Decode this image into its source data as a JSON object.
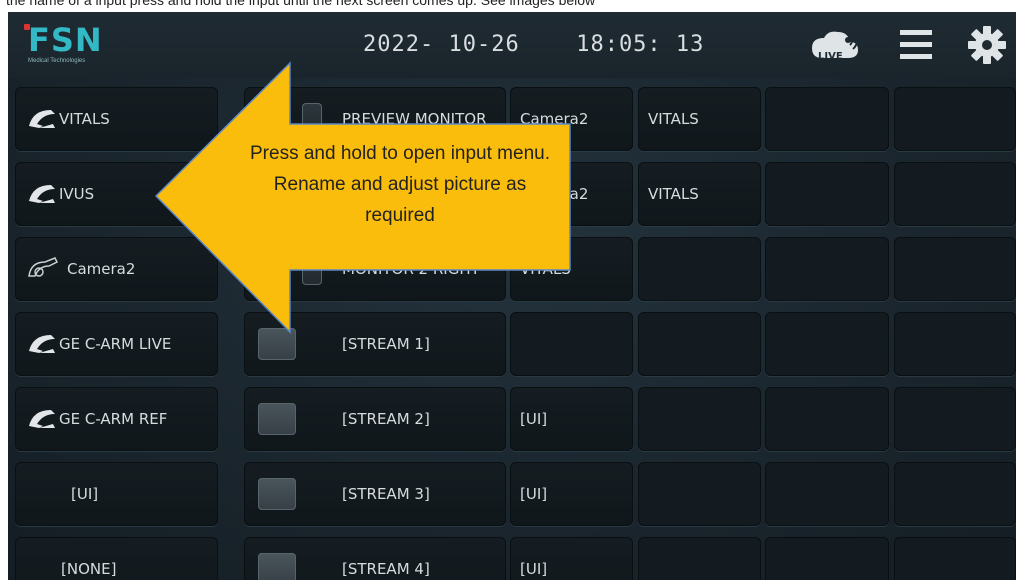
{
  "caption": "the name of a input press and hold the input until the next screen comes up. See images below",
  "header": {
    "brand": "FSN",
    "brand_sub": "Medical Technologies",
    "date": "2022- 10-26",
    "time": "18:05: 13",
    "live_label": "LIVE"
  },
  "inputs": [
    {
      "label": "VITALS",
      "icon": "c-arm-icon"
    },
    {
      "label": "IVUS",
      "icon": "c-arm-icon"
    },
    {
      "label": "Camera2",
      "icon": "camera-icon"
    },
    {
      "label": "GE  C-ARM LIVE",
      "icon": "c-arm-icon"
    },
    {
      "label": "GE C-ARM REF",
      "icon": "c-arm-icon"
    },
    {
      "label": "[UI]",
      "icon": ""
    },
    {
      "label": "[NONE]",
      "icon": ""
    }
  ],
  "monitors": [
    {
      "label": "PREVIEW MONITOR"
    },
    {
      "label": ""
    },
    {
      "label": "MONITOR 2 RIGHT"
    },
    {
      "label": "[STREAM 1]"
    },
    {
      "label": "[STREAM 2]"
    },
    {
      "label": "[STREAM 3]"
    },
    {
      "label": "[STREAM 4]"
    }
  ],
  "col3": [
    "Camera2",
    "Camera2",
    "VITALS",
    "",
    "[UI]",
    "[UI]",
    "[UI]"
  ],
  "col4": [
    "VITALS",
    "VITALS",
    "",
    "",
    "",
    "",
    ""
  ],
  "callout": {
    "text": "Press and hold to open input menu. Rename and adjust picture as required",
    "color": "#fbbd0b",
    "border": "#5a87c6"
  },
  "colors": {
    "accent": "#33b9c6",
    "background": "#1a252d"
  }
}
